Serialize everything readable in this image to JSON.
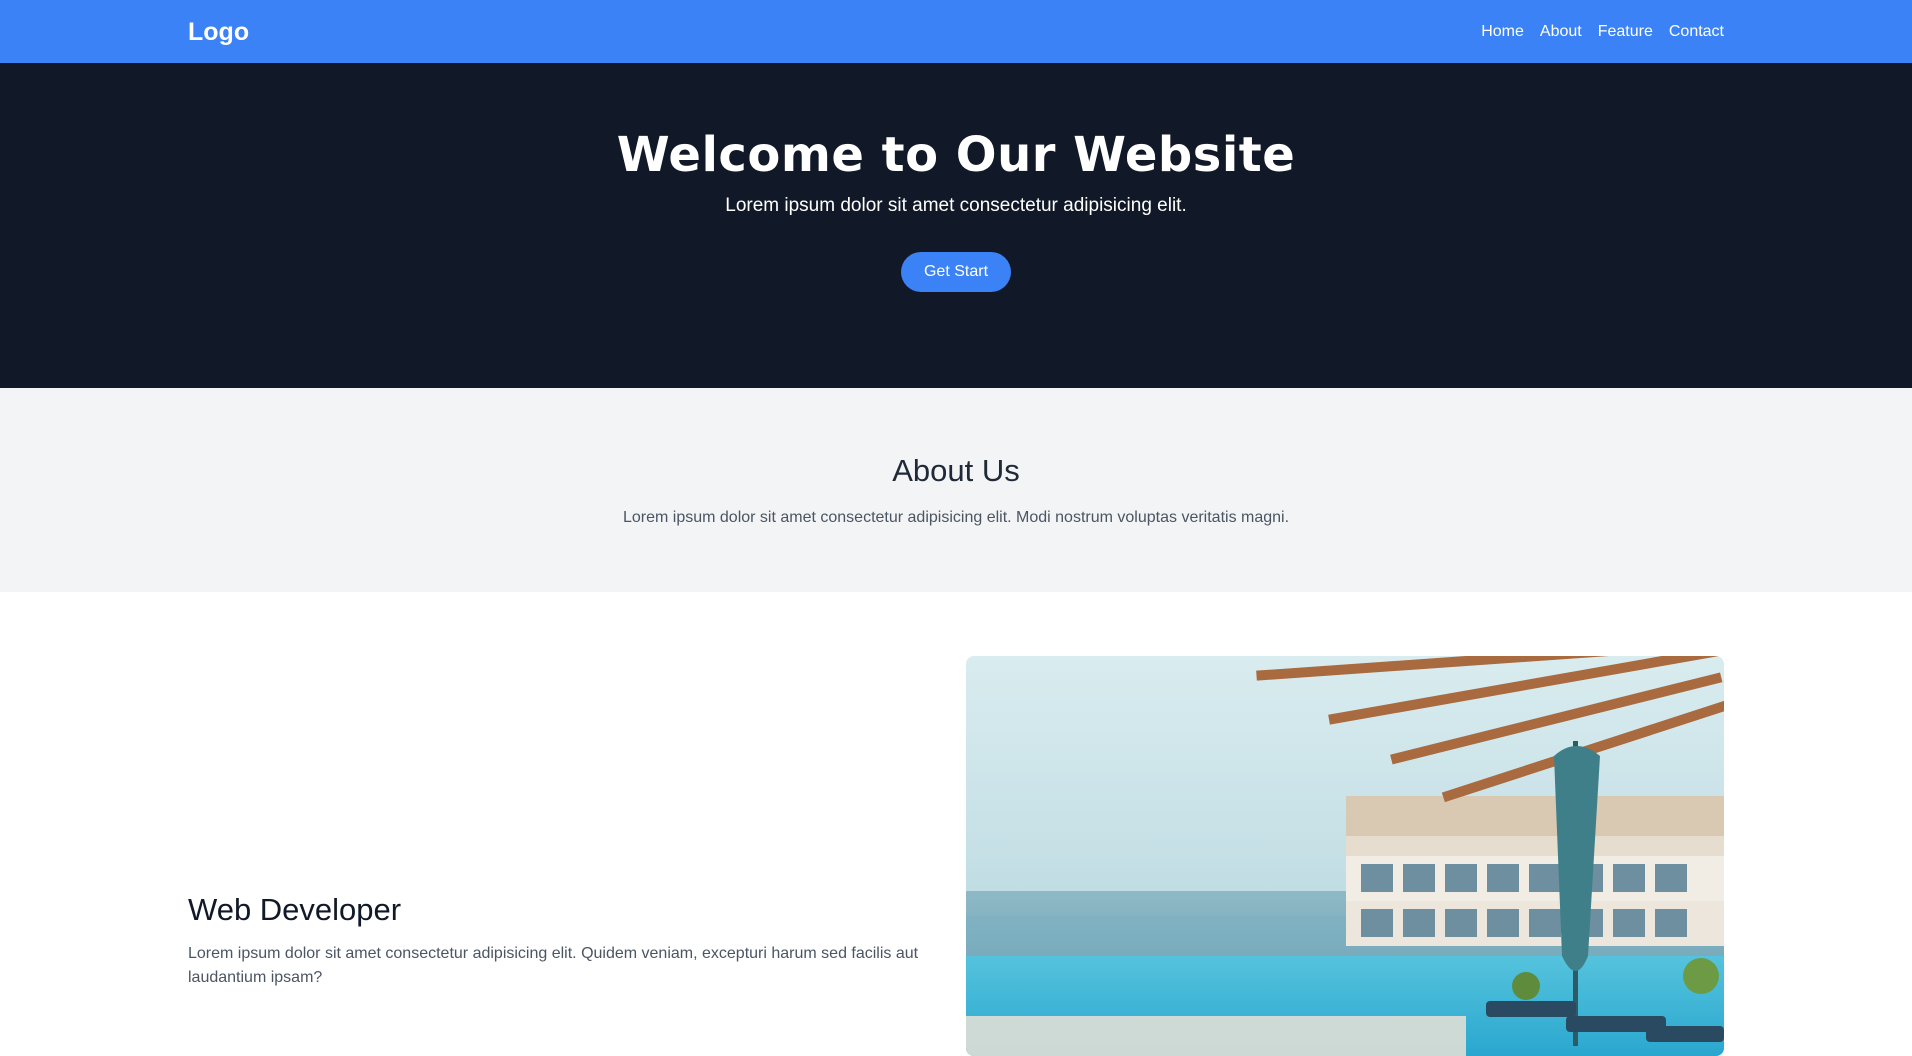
{
  "navbar": {
    "logo": "Logo",
    "links": [
      "Home",
      "About",
      "Feature",
      "Contact"
    ]
  },
  "hero": {
    "title": "Welcome to Our Website",
    "subtitle": "Lorem ipsum dolor sit amet consectetur adipisicing elit.",
    "button_label": "Get Start"
  },
  "about": {
    "title": "About Us",
    "text": "Lorem ipsum dolor sit amet consectetur adipisicing elit. Modi nostrum voluptas veritatis magni."
  },
  "feature": {
    "title": "Web Developer",
    "text": "Lorem ipsum dolor sit amet consectetur adipisicing elit. Quidem veniam, excepturi harum sed facilis aut laudantium ipsam?"
  },
  "colors": {
    "accent": "#3b82f6",
    "hero_bg": "#111827",
    "about_bg": "#f3f4f6"
  }
}
